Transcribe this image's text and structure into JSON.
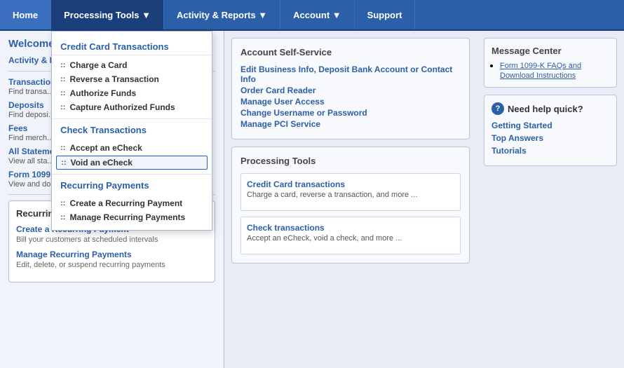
{
  "nav": {
    "home": "Home",
    "processing_tools": "Processing Tools ▼",
    "activity_reports": "Activity & Reports ▼",
    "account": "Account ▼",
    "support": "Support"
  },
  "dropdown": {
    "sections": [
      {
        "title": "Credit Card Transactions",
        "items": [
          "Charge a Card",
          "Reverse a Transaction",
          "Authorize Funds",
          "Capture Authorized Funds"
        ]
      },
      {
        "title": "Check Transactions",
        "items": [
          "Accept an eCheck",
          "Void an eCheck"
        ]
      },
      {
        "title": "Recurring Payments",
        "items": [
          "Create a Recurring Payment",
          "Manage Recurring Payments"
        ]
      }
    ]
  },
  "left": {
    "welcome": "Welcome to",
    "activity_label": "Activity & R...",
    "links": [
      {
        "label": "Transactions",
        "desc": "Find transa..."
      },
      {
        "label": "Deposits",
        "desc": "Find deposi..."
      },
      {
        "label": "Fees",
        "desc": "Find merch..."
      },
      {
        "label": "All Statements",
        "desc": "View all sta..."
      },
      {
        "label": "Form 1099",
        "desc": "View and do..."
      }
    ],
    "recurring_title": "Recurring Payments",
    "recurring_items": [
      {
        "label": "Create a Recurring Payment",
        "desc": "Bill your customers at scheduled intervals"
      },
      {
        "label": "Manage Recurring Payments",
        "desc": "Edit, delete, or suspend recurring payments"
      }
    ]
  },
  "center": {
    "account_self_service": {
      "title": "Account Self-Service",
      "links": [
        {
          "label": "Edit Business Info, Deposit Bank Account or Contact Info",
          "desc": ""
        },
        {
          "label": "Order Card Reader",
          "desc": ""
        },
        {
          "label": "Manage User Access",
          "desc": ""
        },
        {
          "label": "Change Username or Password",
          "desc": ""
        },
        {
          "label": "Manage PCI Service",
          "desc": ""
        }
      ]
    },
    "processing_tools": {
      "title": "Processing Tools",
      "items": [
        {
          "label": "Credit Card transactions",
          "desc": "Charge a card, reverse a transaction, and more ..."
        },
        {
          "label": "Check transactions",
          "desc": "Accept an eCheck, void a check, and more ..."
        }
      ]
    }
  },
  "right": {
    "msg_center_title": "Message Center",
    "msg_link": "Form 1099-K FAQs and Download Instructions",
    "help_title": "Need help quick?",
    "help_links": [
      "Getting Started",
      "Top Answers",
      "Tutorials"
    ]
  }
}
